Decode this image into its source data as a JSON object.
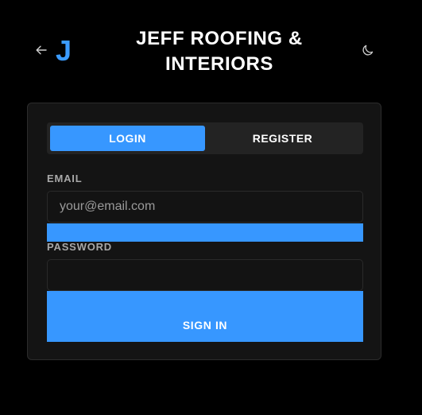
{
  "header": {
    "back_icon": "arrow-left-icon",
    "logo_letter": "J",
    "title": "JEFF ROOFING & INTERIORS",
    "theme_icon": "moon-icon"
  },
  "auth": {
    "tabs": [
      {
        "label": "LOGIN",
        "active": true
      },
      {
        "label": "REGISTER",
        "active": false
      }
    ],
    "email": {
      "label": "EMAIL",
      "value": "",
      "placeholder": "your@email.com"
    },
    "password": {
      "label": "PASSWORD",
      "value": "",
      "placeholder": ""
    },
    "submit_label": "SIGN IN"
  },
  "colors": {
    "background": "#000000",
    "card": "#141414",
    "accent": "#3797ff",
    "text": "#ffffff",
    "muted": "#a8a8a8"
  }
}
